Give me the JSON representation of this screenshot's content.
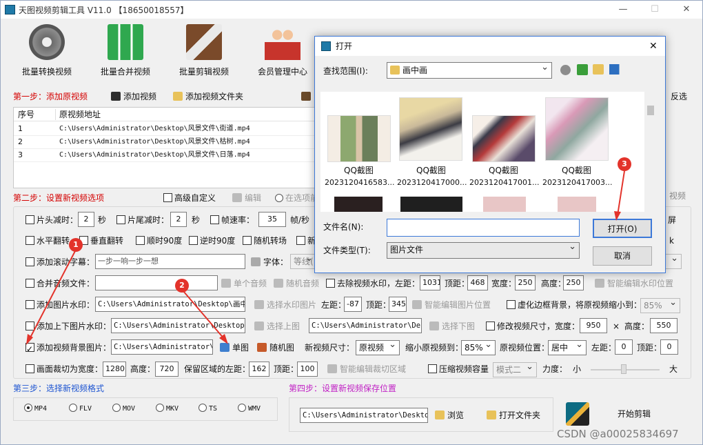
{
  "window": {
    "title": "天图视频剪辑工具 V11.0  【18650018557】",
    "min": "—",
    "max": "☐",
    "close": "✕"
  },
  "toolbar": {
    "batch_convert": "批量转换视频",
    "batch_merge": "批量合并视频",
    "batch_edit": "批量剪辑视频",
    "member": "会员管理中心"
  },
  "step1": {
    "title": "第一步：添加原视频",
    "add_video": "添加视频",
    "add_folder": "添加视频文件夹",
    "invert": "反选",
    "col_index": "序号",
    "col_path": "原视频地址",
    "rows": [
      {
        "i": "1",
        "path": "C:\\Users\\Administrator\\Desktop\\风景文件\\街道.mp4"
      },
      {
        "i": "2",
        "path": "C:\\Users\\Administrator\\Desktop\\风景文件\\枯树.mp4"
      },
      {
        "i": "3",
        "path": "C:\\Users\\Administrator\\Desktop\\风景文件\\日落.mp4"
      }
    ]
  },
  "step2": {
    "title": "第二步：设置新视频选项",
    "advanced": "高级自定义",
    "edit": "编辑",
    "in_options": "在选项前",
    "video_cut": "视频",
    "head_cut": "片头减时：",
    "head_val": "2",
    "sec": "秒",
    "tail_cut": "片尾减时：",
    "tail_val": "2",
    "sec2": "秒",
    "fps": "帧速率：",
    "fps_val": "35",
    "fps_unit": "帧/秒",
    "hflip": "水平翻转",
    "vflip": "垂直翻转",
    "cw90": "顺时90度",
    "ccw90": "逆时90度",
    "rand_trans": "随机转场",
    "new": "新",
    "subtitle": "添加滚动字幕：",
    "subtitle_val": "一步一响一步一想",
    "font": "字体：",
    "font_val": "等线(",
    "merge_audio": "合并音频文件：",
    "single_audio": "单个音频",
    "random_audio": "随机音频",
    "remove_wm": "去除视频水印，左距：",
    "rw_left": "1031",
    "rw_top_lbl": "顶距：",
    "rw_top": "468",
    "rw_w_lbl": "宽度：",
    "rw_w": "250",
    "rw_h_lbl": "高度：",
    "rw_h": "250",
    "smart_wm": "智能编辑水印位置",
    "img_wm": "添加图片水印：",
    "img_wm_path": "C:\\Users\\Administrator\\Desktop\\画中画",
    "choose_wm": "选择水印图片",
    "iw_left_lbl": "左距：",
    "iw_left": "-87",
    "iw_top_lbl": "顶距：",
    "iw_top": "345",
    "smart_img": "智能编辑图片位置",
    "blur_border": "虚化边框背景，将原视频缩小到：",
    "blur_val": "85%",
    "topbot": "添加上下图片水印：",
    "top_path": "C:\\Users\\Administrator\\Desktop\\A",
    "choose_top": "选择上图",
    "bot_path": "C:\\Users\\Administrator\\Desk",
    "choose_bot": "选择下图",
    "resize": "修改视频尺寸，宽度：",
    "resize_w": "950",
    "times": "×",
    "resize_h_lbl": "高度：",
    "resize_h": "550",
    "bg_img": "添加视频背景图片：",
    "bg_path": "C:\\Users\\Administrator\\D",
    "single_img": "单图",
    "random_img": "随机图",
    "new_size": "新视频尺寸：",
    "new_size_val": "原视频",
    "shrink": "缩小原视频到：",
    "shrink_val": "85%",
    "pos": "原视频位置：",
    "pos_val": "居中",
    "pos_left_lbl": "左距：",
    "pos_left": "0",
    "pos_top_lbl": "顶距：",
    "pos_top": "0",
    "crop": "画面裁切为宽度：",
    "crop_w": "1280",
    "crop_h_lbl": "高度：",
    "crop_h": "720",
    "keep": "保留区域的左距：",
    "keep_left": "162",
    "keep_top_lbl": "顶距：",
    "keep_top": "100",
    "smart_crop": "智能编辑裁切区域",
    "compress": "压缩视频容量",
    "mode": "模式二",
    "strength": "力度：",
    "small": "小",
    "big": "大",
    "partial_right": "屏",
    "partial_k": "k"
  },
  "step3": {
    "title": "第三步：选择新视频格式",
    "formats": [
      "MP4",
      "FLV",
      "MOV",
      "MKV",
      "TS",
      "WMV"
    ]
  },
  "step4": {
    "title": "第四步：设置新视频保存位置",
    "path": "C:\\Users\\Administrator\\Desktop",
    "browse": "浏览",
    "open_folder": "打开文件夹",
    "start": "开始剪辑"
  },
  "dialog": {
    "title": "打开",
    "look_in": "查找范围(I):",
    "folder": "画中画",
    "filename": "文件名(N):",
    "filetype": "文件类型(T):",
    "filetype_val": "图片文件",
    "open": "打开(O)",
    "cancel": "取消",
    "files": [
      {
        "name": "QQ截图",
        "sub": "2023120416583..."
      },
      {
        "name": "QQ截图",
        "sub": "2023120417000..."
      },
      {
        "name": "QQ截图",
        "sub": "2023120417001..."
      },
      {
        "name": "QQ截图",
        "sub": "2023120417003..."
      }
    ]
  },
  "markers": [
    "1",
    "2",
    "3"
  ],
  "watermark": "CSDN @a00025834697",
  "colors": {
    "accent": "#d40000",
    "step_blue": "#1d54d1",
    "step_purple": "#c01fc4",
    "marker": "#e3332b"
  }
}
